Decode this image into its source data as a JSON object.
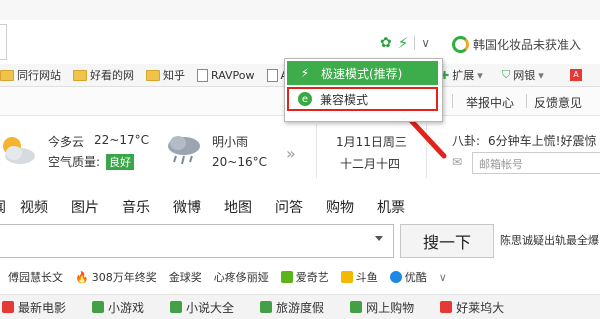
{
  "addressbar": {
    "search_extension_text": "韩国化妆品未获准入"
  },
  "bookmarks": {
    "items": [
      {
        "label": "同行网站",
        "icon": "folder-icon"
      },
      {
        "label": "好看的网",
        "icon": "folder-icon"
      },
      {
        "label": "知乎",
        "icon": "folder-icon"
      },
      {
        "label": "RAVPow",
        "icon": "page-icon"
      },
      {
        "label": "A",
        "icon": "page-icon"
      }
    ],
    "extend_label": "扩展",
    "bank_label": "网银"
  },
  "pagebar": {
    "report_center": "举报中心",
    "feedback": "反馈意见"
  },
  "weather": {
    "today_label": "今多云",
    "today_temp": "22~17°C",
    "aq_label": "空气质量:",
    "aq_value": "良好",
    "tomorrow_label": "明小雨",
    "tomorrow_temp": "20~16°C",
    "date_gregorian": "1月11日周三",
    "date_lunar": "十二月十四",
    "news_label": "八卦:",
    "news_text": "6分钟车上慌!好震惊",
    "mail_placeholder": "邮箱帐号"
  },
  "navtabs": [
    "闻",
    "视频",
    "图片",
    "音乐",
    "微博",
    "地图",
    "问答",
    "购物",
    "机票"
  ],
  "search": {
    "button_label": "搜一下",
    "hot_right": "陈思诚疑出轨最全爆"
  },
  "hotlinks": [
    {
      "label": "傅园慧长文",
      "icon_color": "#ffffff"
    },
    {
      "label": "308万年终奖",
      "icon_color": "#f57c00"
    },
    {
      "label": "金球奖",
      "icon_color": "#ffffff"
    },
    {
      "label": "心疼侈丽娅",
      "icon_color": "#ffffff"
    },
    {
      "label": "爱奇艺",
      "icon_color": "#5bb41a"
    },
    {
      "label": "斗鱼",
      "icon_color": "#f5b800"
    },
    {
      "label": "优酷",
      "icon_color": "#1e88e5"
    }
  ],
  "bottomnav": [
    {
      "label": "最新电影",
      "icon_color": "#e53935"
    },
    {
      "label": "小游戏",
      "icon_color": "#43a047"
    },
    {
      "label": "小说大全",
      "icon_color": "#43a047"
    },
    {
      "label": "旅游度假",
      "icon_color": "#43a047"
    },
    {
      "label": "网上购物",
      "icon_color": "#43a047"
    },
    {
      "label": "好莱坞大",
      "icon_color": "#e53935"
    }
  ],
  "menu": {
    "fast_mode": "极速模式(推荐)",
    "compat_mode": "兼容模式"
  },
  "colors": {
    "menu_green": "#3dac4a",
    "highlight_red": "#e2231a",
    "aq_green": "#3aa64a"
  }
}
